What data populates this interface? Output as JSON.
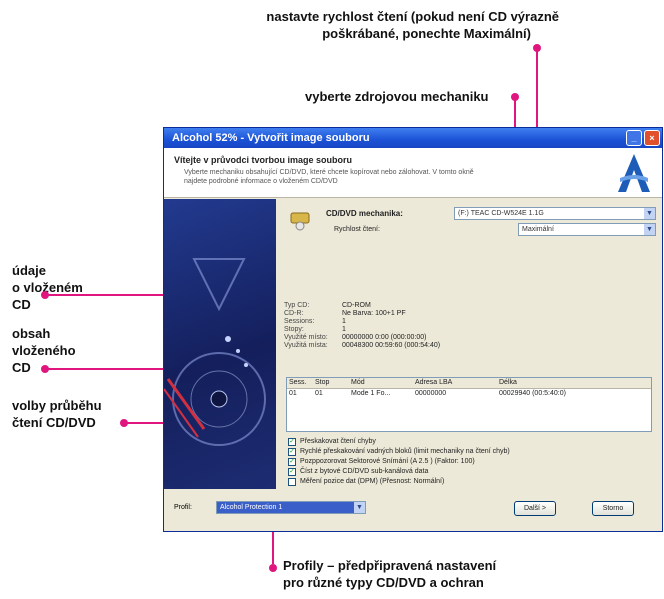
{
  "callouts": {
    "read_speed_line1": "nastavte rychlost čtení (pokud není CD výrazně",
    "read_speed_line2": "poškrábané, ponechte Maximální)",
    "source_drive": "vyberte zdrojovou mechaniku",
    "cd_info_line1": "údaje",
    "cd_info_line2": "o vloženém",
    "cd_info_line3": "CD",
    "cd_content_line1": "obsah",
    "cd_content_line2": "vloženého",
    "cd_content_line3": "CD",
    "read_options_line1": "volby průběhu",
    "read_options_line2": "čtení CD/DVD",
    "profiles_line1": "Profily – předpřipravená nastavení",
    "profiles_line2": "pro různé typy CD/DVD a ochran",
    "accent_color": "#e0157e"
  },
  "window": {
    "title": "Alcohol 52% - Vytvořit image souboru",
    "header_title": "Vítejte v průvodci tvorbou image souboru",
    "header_desc": "Vyberte mechaniku obsahující CD/DVD, které chcete kopírovat nebo zálohovat. V tomto okně najdete podrobné informace o vloženém CD/DVD",
    "drive_label": "CD/DVD mechanika:",
    "drive_value": "(F:) TEAC CD-W524E 1.1G",
    "speed_label": "Rychlost čtení:",
    "speed_value": "Maximální",
    "info": [
      {
        "k": "Typ CD:",
        "v": "CD-ROM"
      },
      {
        "k": "CD-R:",
        "v": "Ne     Barva:  100+1 PF"
      },
      {
        "k": "Sessions:",
        "v": "1"
      },
      {
        "k": "Stopy:",
        "v": "1"
      },
      {
        "k": "Využité místo:",
        "v": "00000000   0:00   (000:00:00)"
      },
      {
        "k": "Využitá místa:",
        "v": "00048300   00:59:60   (000:54:40)"
      }
    ],
    "table_headers": [
      "Sess.",
      "Stop",
      "Mód",
      "Adresa LBA",
      "Délka"
    ],
    "table_rows": [
      [
        "01",
        "01",
        "Mode 1 Fo...",
        "00000000",
        "00029940 (00:5:40:0)"
      ]
    ],
    "options": [
      {
        "label": "Přeskakovat čtení chyby",
        "checked": true
      },
      {
        "label": "Rychlé přeskakování vadných bloků (limit mechaniky na čtení chyb)",
        "checked": true
      },
      {
        "label": "Pozppozorovat Sektorové Snímání (A 2.5 )   (Faktor: 100)",
        "checked": true
      },
      {
        "label": "Číst z bytové CD/DVD sub-kanálová data",
        "checked": true
      },
      {
        "label": "Měření pozice dat (DPM)   (Přesnost: Normální)",
        "checked": false
      }
    ],
    "profile_label": "Profil:",
    "profile_value": "Alcohol Protection 1",
    "next_button": "Další >",
    "cancel_button": "Storno"
  }
}
